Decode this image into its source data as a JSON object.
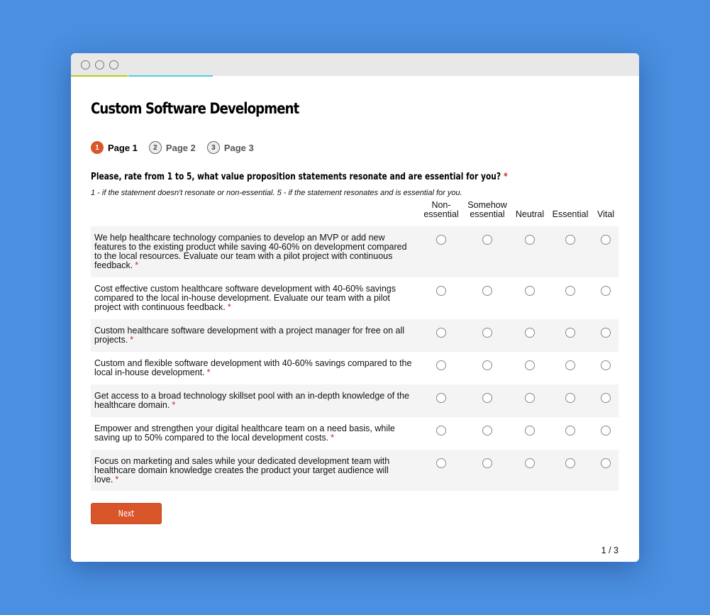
{
  "window": {
    "controls": [
      "close",
      "minimize",
      "maximize"
    ],
    "progress_colors": [
      "#b5cc18",
      "#4dd0d6"
    ]
  },
  "survey": {
    "title": "Custom Software Development",
    "pages": [
      {
        "number": "1",
        "label": "Page 1",
        "active": true
      },
      {
        "number": "2",
        "label": "Page 2",
        "active": false
      },
      {
        "number": "3",
        "label": "Page 3",
        "active": false
      }
    ],
    "question": "Please, rate from 1 to 5, what value proposition statements resonate and are essential for you?",
    "required_mark": "*",
    "description": "1 - if the statement doesn't resonate or non-essential. 5 - if the statement resonates and is essential for you.",
    "columns": [
      "Non-\nessential",
      "Somehow\nessential",
      "Neutral",
      "Essential",
      "Vital"
    ],
    "rows": [
      "We help healthcare technology companies to develop an MVP or add new features to the existing product while saving 40-60% on development compared to the local resources. Evaluate our team with a pilot project with continuous feedback.",
      "Cost effective custom healthcare software development with 40-60% savings compared to the local in-house development. Evaluate our team with a pilot project with continuous feedback.",
      "Custom healthcare software development with a project manager for free on all projects.",
      "Custom and flexible software development with 40-60% savings compared to the local in-house development.",
      "Get access to a broad technology skillset pool with an in-depth knowledge of the healthcare domain.",
      "Empower and strengthen your digital healthcare team on a need basis, while saving up to 50% compared to the local development costs.",
      "Focus on marketing and sales while your dedicated development team with healthcare domain knowledge creates the product your target audience will love."
    ],
    "next_label": "Next",
    "page_indicator": "1 / 3",
    "accent_color": "#d9552a"
  }
}
